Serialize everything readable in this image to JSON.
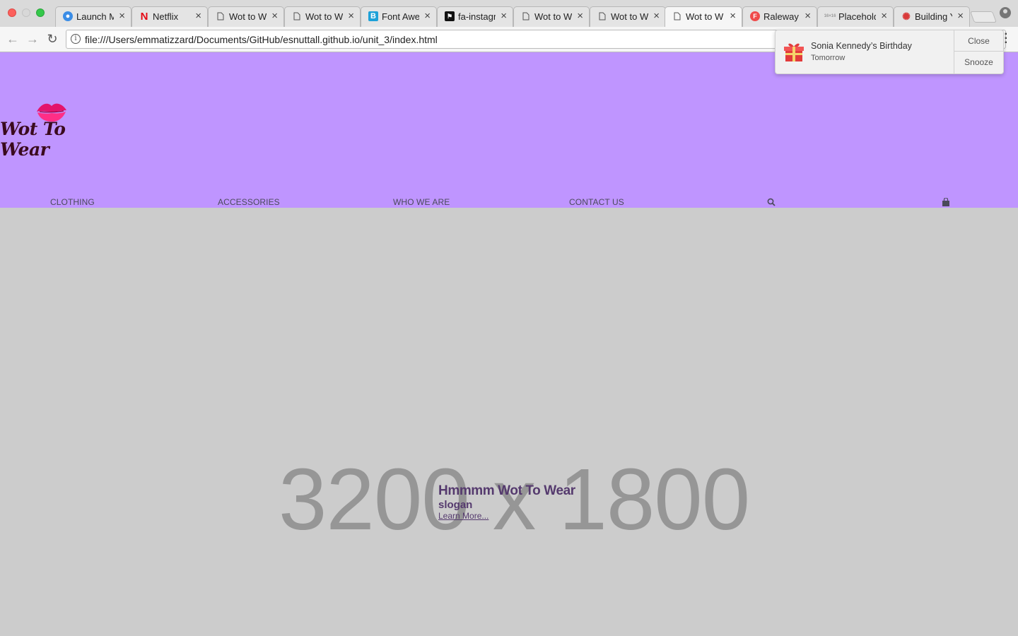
{
  "browser": {
    "tabs": [
      {
        "label": "Launch M",
        "favicon": "launch-icon",
        "color": "#3b8de6"
      },
      {
        "label": "Netflix",
        "favicon": "netflix-icon",
        "color": "#e50914"
      },
      {
        "label": "Wot to W",
        "favicon": "page-icon"
      },
      {
        "label": "Wot to W",
        "favicon": "page-icon"
      },
      {
        "label": "Font Awe",
        "favicon": "font-awesome-icon",
        "color": "#1da1d8"
      },
      {
        "label": "fa-instagr",
        "favicon": "flag-icon"
      },
      {
        "label": "Wot to W",
        "favicon": "page-icon"
      },
      {
        "label": "Wot to W",
        "favicon": "page-icon"
      },
      {
        "label": "Wot to W",
        "favicon": "page-icon",
        "active": true
      },
      {
        "label": "Raleway -",
        "favicon": "raleway-icon",
        "color": "#ef4b4b"
      },
      {
        "label": "Placehold",
        "favicon": "placeholder-icon"
      },
      {
        "label": "Building Y",
        "favicon": "building-icon",
        "color": "#d93a3a"
      }
    ],
    "url": "file:///Users/emmatizzard/Documents/GitHub/esnuttall.github.io/unit_3/index.html"
  },
  "notification": {
    "title": "Sonia Kennedy’s Birthday",
    "subtitle": "Tomorrow",
    "close_label": "Close",
    "snooze_label": "Snooze"
  },
  "site": {
    "logo_text": "Wot To Wear",
    "nav": {
      "clothing": "CLOTHING",
      "accessories": "ACCESSORIES",
      "who_we_are": "WHO WE ARE",
      "contact_us": "CONTACT US"
    },
    "colors": {
      "header_bg": "#bf95ff",
      "hero_bg": "#cccccc",
      "text_purple": "#553a6e"
    },
    "hero": {
      "placeholder_text": "3200 x 1800",
      "heading": "Hmmmm Wot To Wear",
      "slogan": "slogan",
      "learn_more": "Learn More..."
    }
  }
}
